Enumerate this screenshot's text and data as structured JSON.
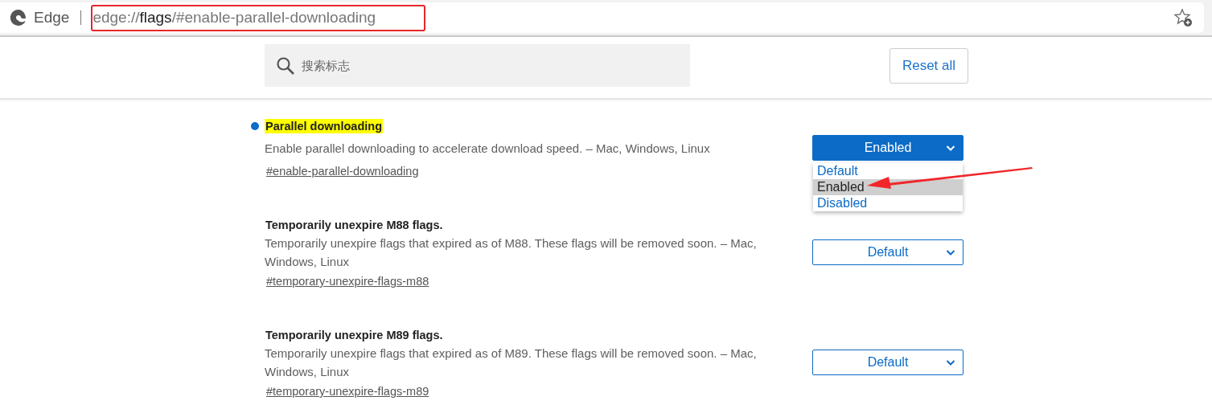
{
  "toolbar": {
    "browser_name": "Edge",
    "url": "edge://**flags**/#enable-parallel-downloading"
  },
  "header": {
    "search": {
      "placeholder": "搜索标志"
    },
    "reset_button": "Reset all"
  },
  "flags": [
    {
      "title": "Parallel downloading",
      "highlighted": true,
      "modified": true,
      "description": "Enable parallel downloading to accelerate download speed. – Mac, Windows, Linux",
      "link": "#enable-parallel-downloading",
      "value": "Enabled",
      "options": [
        {
          "label": "Default",
          "selected": false
        },
        {
          "label": "Enabled",
          "selected": true
        },
        {
          "label": "Disabled",
          "selected": false
        }
      ]
    },
    {
      "title": "Temporarily unexpire M88 flags.",
      "highlighted": false,
      "modified": false,
      "description": "Temporarily unexpire flags that expired as of M88. These flags will be removed soon. – Mac, Windows, Linux",
      "link": "#temporary-unexpire-flags-m88",
      "value": "Default"
    },
    {
      "title": "Temporarily unexpire M89 flags.",
      "highlighted": false,
      "modified": false,
      "description": "Temporarily unexpire flags that expired as of M89. These flags will be removed soon. – Mac, Windows, Linux",
      "link": "#temporary-unexpire-flags-m89",
      "value": "Default"
    }
  ]
}
